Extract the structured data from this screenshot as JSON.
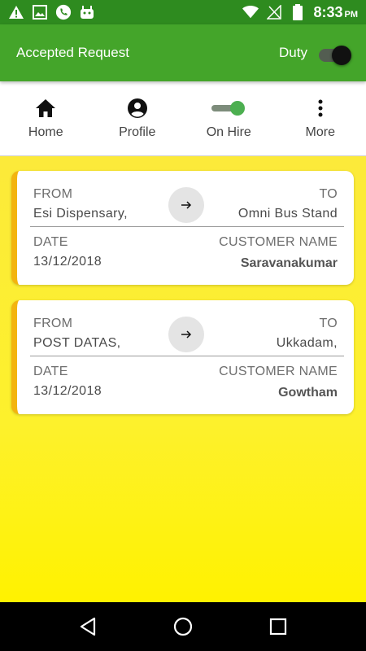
{
  "status_bar": {
    "time": "8:33",
    "ampm": "PM",
    "left_icons": [
      "warning-icon",
      "image-icon",
      "phone-icon",
      "android-icon"
    ],
    "right_icons": [
      "wifi-icon",
      "no-signal-icon",
      "battery-icon"
    ]
  },
  "app_bar": {
    "title": "Accepted Request",
    "duty_label": "Duty",
    "duty_on": true
  },
  "nav": {
    "items": [
      {
        "label": "Home",
        "icon": "home-icon"
      },
      {
        "label": "Profile",
        "icon": "account-circle-icon"
      },
      {
        "label": "On Hire",
        "icon": "toggle-on-icon"
      },
      {
        "label": "More",
        "icon": "more-vertical-icon"
      }
    ]
  },
  "requests": [
    {
      "from_label": "FROM",
      "from": "Esi Dispensary,",
      "to_label": "TO",
      "to": "Omni Bus Stand",
      "date_label": "DATE",
      "date": "13/12/2018",
      "customer_label": "CUSTOMER NAME",
      "customer": "Saravanakumar"
    },
    {
      "from_label": "FROM",
      "from": "POST DATAS,",
      "to_label": "TO",
      "to": "Ukkadam,",
      "date_label": "DATE",
      "date": "13/12/2018",
      "customer_label": "CUSTOMER NAME",
      "customer": "Gowtham"
    }
  ],
  "colors": {
    "status_bar": "#2e8b1f",
    "app_bar": "#44a52a",
    "card_accent": "#f3b40f",
    "background_yellow": "#fdf12c",
    "toggle_green": "#4caf50"
  }
}
